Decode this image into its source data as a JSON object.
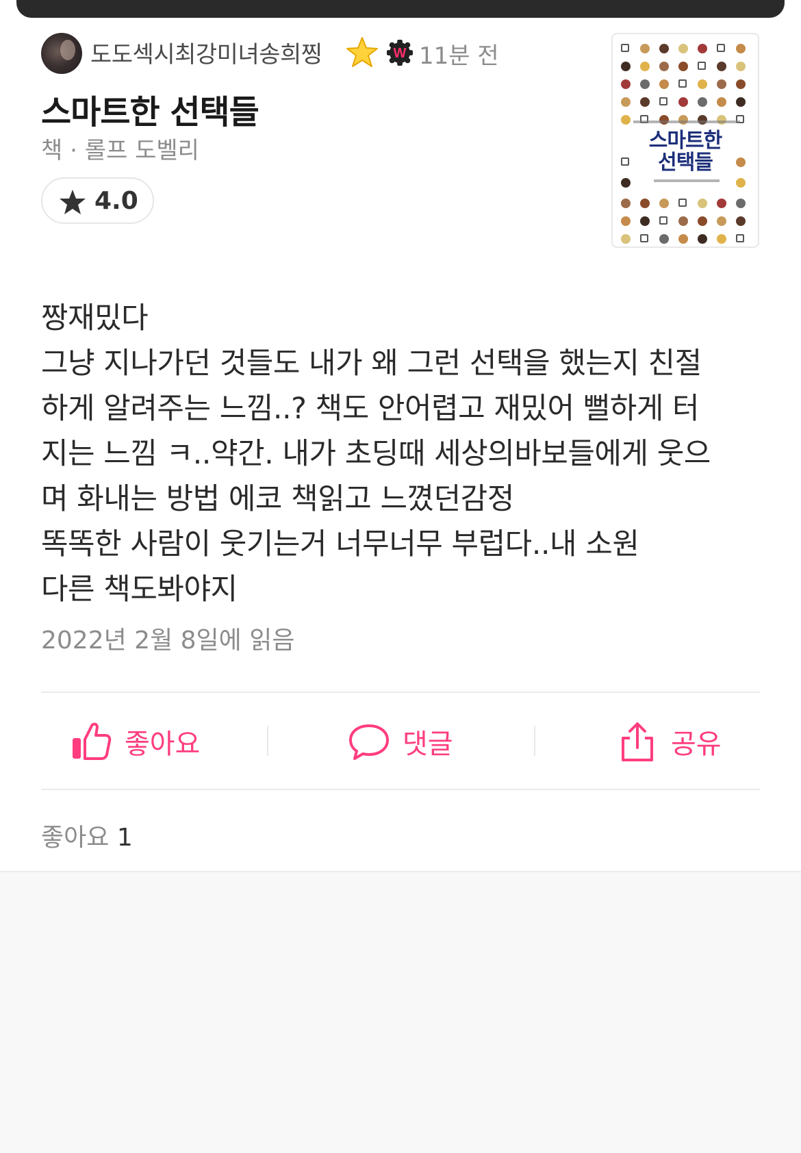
{
  "header": {
    "username": "도도섹시최강미녀송희찡",
    "user_badge_icon": "star-emoji-icon",
    "user_badge_letter": "W",
    "time_ago": "11분 전"
  },
  "item": {
    "title": "스마트한 선택들",
    "meta": "책 · 롤프 도벨리",
    "rating": "4.0",
    "cover_title_line1": "스마트한",
    "cover_title_line2": "선택들"
  },
  "review": {
    "text": "짱재밌다\n그냥 지나가던 것들도 내가 왜 그런 선택을 했는지 친절\n하게 알려주는 느낌..? 책도 안어렵고 재밌어 뻘하게 터\n지는 느낌 ㅋ..약간. 내가 초딩때 세상의바보들에게 웃으\n며 화내는 방법 에코 책읽고 느꼈던감정\n똑똑한 사람이 웃기는거 너무너무 부럽다..내 소원\n다른 책도봐야지",
    "read_date": "2022년 2월 8일에 읽음"
  },
  "actions": {
    "like_label": "좋아요",
    "comment_label": "댓글",
    "share_label": "공유"
  },
  "stats": {
    "likes_label": "좋아요",
    "likes_count": "1"
  },
  "colors": {
    "accent": "#ff3d7f",
    "muted_text": "#8c8c8c",
    "cover_title": "#1d2f7a"
  }
}
